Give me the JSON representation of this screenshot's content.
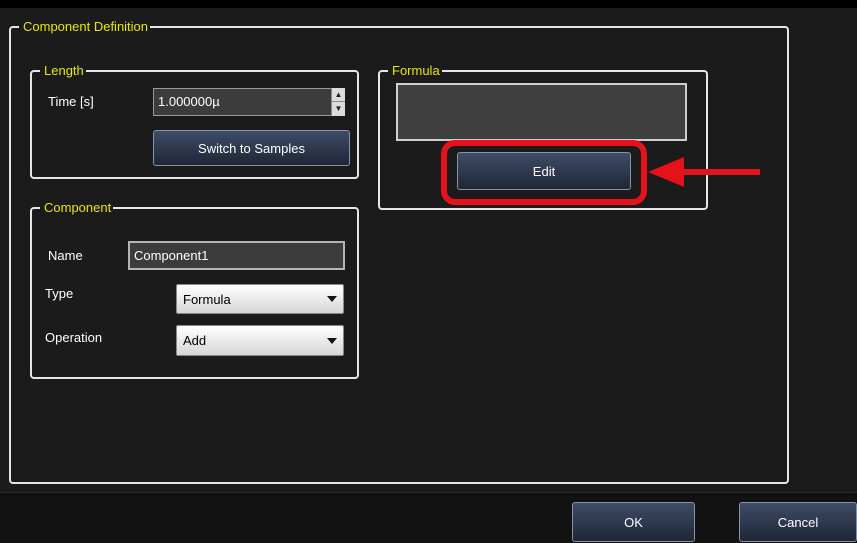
{
  "dialog": {
    "title": "Component Definition"
  },
  "length": {
    "title": "Length",
    "time_label": "Time [s]",
    "time_value": "1.000000µ",
    "switch_button": "Switch to Samples"
  },
  "formula": {
    "title": "Formula",
    "value": "",
    "edit_button": "Edit"
  },
  "component": {
    "title": "Component",
    "name_label": "Name",
    "name_value": "Component1",
    "type_label": "Type",
    "type_value": "Formula",
    "operation_label": "Operation",
    "operation_value": "Add"
  },
  "footer": {
    "ok_button": "OK",
    "cancel_button": "Cancel"
  },
  "colors": {
    "legend_text": "#e8e800",
    "highlight": "#e3121b",
    "background": "#1b1b1b"
  },
  "icons": [
    "spin-up-icon",
    "spin-down-icon",
    "dropdown-arrow-icon",
    "red-pointer-arrow-icon"
  ]
}
